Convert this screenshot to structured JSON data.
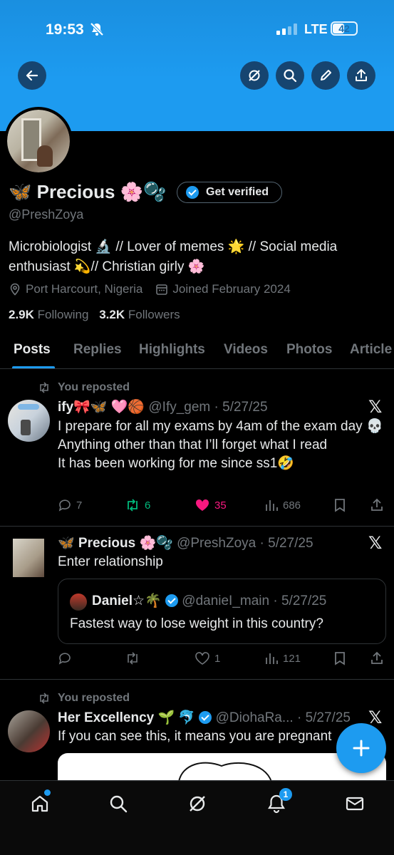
{
  "status_bar": {
    "time": "19:53",
    "network": "LTE",
    "battery": "42"
  },
  "header": {
    "back_icon": "arrow-left-icon",
    "action_icons": [
      "grok-icon",
      "search-icon",
      "pen-icon",
      "share-icon"
    ]
  },
  "profile": {
    "name": "🦋 Precious 🌸🫧",
    "get_verified": "Get verified",
    "handle": "@PreshZoya",
    "bio": "Microbiologist 🔬 // Lover of memes 🌟 // Social media enthusiast 💫// Christian girly 🌸",
    "location": "Port Harcourt, Nigeria",
    "joined": "Joined February 2024",
    "following_count": "2.9K",
    "following_label": "Following",
    "followers_count": "3.2K",
    "followers_label": "Followers"
  },
  "tabs": [
    "Posts",
    "Replies",
    "Highlights",
    "Videos",
    "Photos",
    "Article"
  ],
  "posts": [
    {
      "repost_label": "You reposted",
      "author": "ify🎀🦋 🩷🏀",
      "handle_date": "@Ify_gem · 5/27/25",
      "text_lines": [
        "I prepare for all my exams by 4am of the exam day 💀",
        "Anything other than that I’ll forget what I read",
        "It has been working for me since ss1🤣"
      ],
      "replies": "7",
      "reposts": "6",
      "likes": "35",
      "views": "686"
    },
    {
      "author": "🦋 Precious 🌸🫧",
      "handle_date": "@PreshZoya · 5/27/25",
      "text": "Enter relationship",
      "quote": {
        "author": "Daniel☆🌴",
        "handle_date": "@danieI_main · 5/27/25",
        "text": "Fastest way to lose weight in this country?"
      },
      "replies": "",
      "reposts": "",
      "likes": "1",
      "views": "121"
    },
    {
      "repost_label": "You reposted",
      "author": "Her Excellency 🌱 🐬",
      "handle_date": "@DiohaRa... · 5/27/25",
      "text": "If you can see this, it means you are pregnant"
    }
  ],
  "bottom_nav": {
    "icons": [
      "home-icon",
      "search-icon",
      "grok-icon",
      "notifications-icon",
      "messages-icon"
    ],
    "notification_badge": "1"
  },
  "colors": {
    "accent": "#1d9bf0",
    "like": "#f91880",
    "repost": "#00ba7c",
    "muted": "#71767b"
  }
}
